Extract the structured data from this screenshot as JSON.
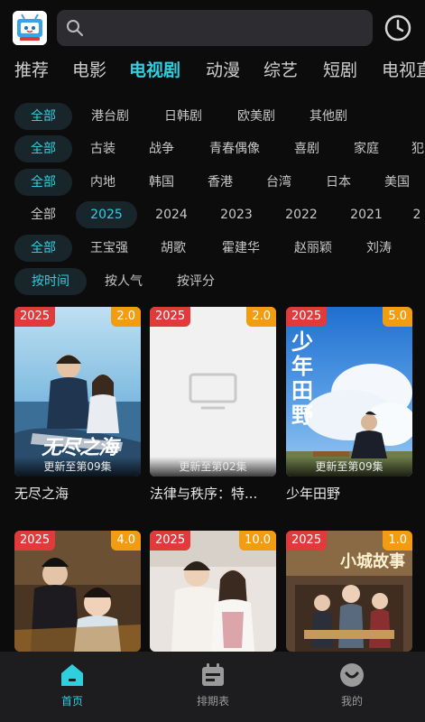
{
  "header": {
    "logo_icon": "tv-logo-icon",
    "search_icon": "search-icon",
    "history_icon": "clock-icon"
  },
  "tabs": [
    "推荐",
    "电影",
    "电视剧",
    "动漫",
    "综艺",
    "短剧",
    "电视直"
  ],
  "active_tab": "电视剧",
  "filters": [
    {
      "name": "region-type",
      "chips": [
        "全部",
        "港台剧",
        "日韩剧",
        "欧美剧",
        "其他剧"
      ],
      "active": "全部"
    },
    {
      "name": "genre",
      "chips": [
        "全部",
        "古装",
        "战争",
        "青春偶像",
        "喜剧",
        "家庭",
        "犯"
      ],
      "active": "全部"
    },
    {
      "name": "region",
      "chips": [
        "全部",
        "内地",
        "韩国",
        "香港",
        "台湾",
        "日本",
        "美国"
      ],
      "active": "全部"
    },
    {
      "name": "year",
      "chips": [
        "全部",
        "2025",
        "2024",
        "2023",
        "2022",
        "2021",
        "2"
      ],
      "active": "2025"
    },
    {
      "name": "actor",
      "chips": [
        "全部",
        "王宝强",
        "胡歌",
        "霍建华",
        "赵丽颖",
        "刘涛"
      ],
      "active": "全部"
    },
    {
      "name": "sort",
      "chips": [
        "按时间",
        "按人气",
        "按评分"
      ],
      "active": "按时间"
    }
  ],
  "cards": [
    {
      "year": "2025",
      "score": "2.0",
      "update": "更新至第09集",
      "title": "无尽之海",
      "poster": "beach-couple-poster",
      "poster_text": "无尽之海"
    },
    {
      "year": "2025",
      "score": "2.0",
      "update": "更新至第02集",
      "title": "法律与秩序：特...",
      "poster": "placeholder-tv-icon",
      "poster_text": ""
    },
    {
      "year": "2025",
      "score": "5.0",
      "update": "更新至第09集",
      "title": "少年田野",
      "poster": "sky-field-poster",
      "poster_text": "少年田野"
    },
    {
      "year": "2025",
      "score": "4.0",
      "update": "",
      "title": "",
      "poster": "costume-drama-poster",
      "poster_text": ""
    },
    {
      "year": "2025",
      "score": "10.0",
      "update": "",
      "title": "",
      "poster": "modern-couple-poster",
      "poster_text": ""
    },
    {
      "year": "2025",
      "score": "1.0",
      "update": "",
      "title": "",
      "poster": "period-drama-poster",
      "poster_text": "小城故事"
    }
  ],
  "bottom_nav": [
    {
      "label": "首页",
      "icon": "home-icon",
      "active": true
    },
    {
      "label": "排期表",
      "icon": "schedule-icon",
      "active": false
    },
    {
      "label": "我的",
      "icon": "profile-icon",
      "active": false
    }
  ],
  "colors": {
    "accent": "#2fcfde",
    "year_badge": "#e03a3a",
    "score_badge": "#f29c11",
    "background": "#0c0c0d"
  }
}
